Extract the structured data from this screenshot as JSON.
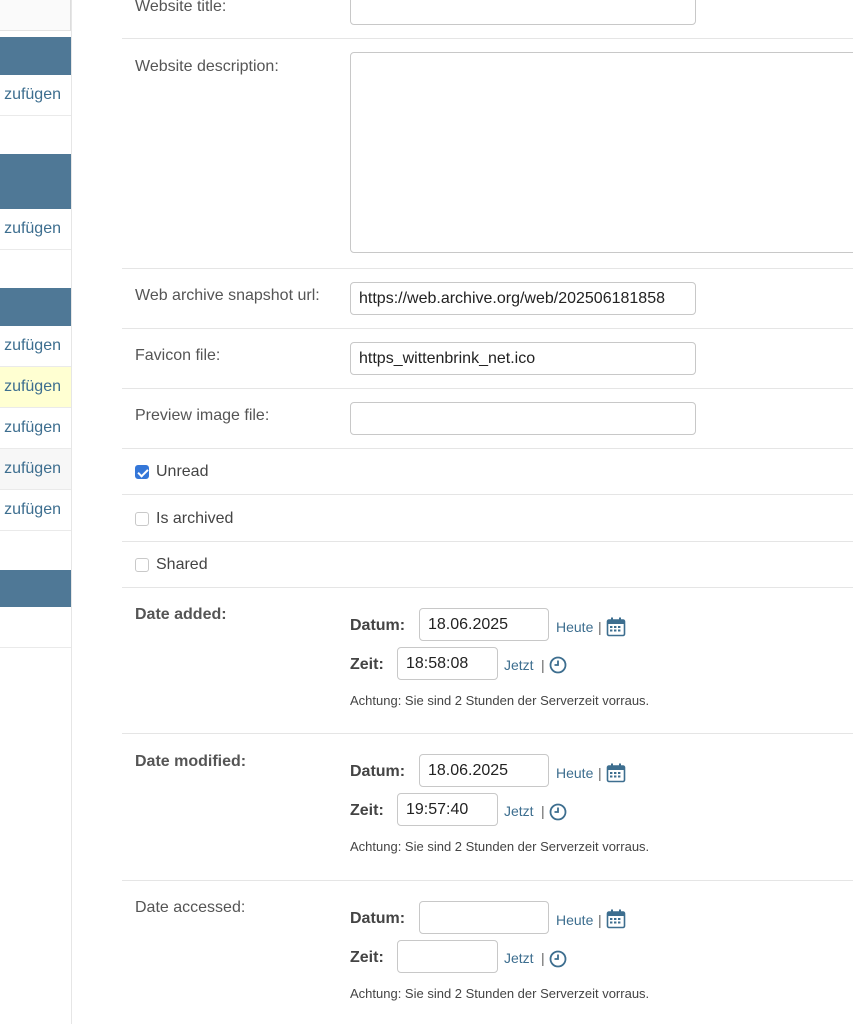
{
  "sidebar": {
    "add_links": [
      {
        "label": "zufügen"
      },
      {
        "label": "zufügen"
      },
      {
        "label": "zufügen"
      },
      {
        "label": "zufügen"
      },
      {
        "label": "zufügen"
      },
      {
        "label": "zufügen"
      },
      {
        "label": "zufügen"
      }
    ]
  },
  "form": {
    "website_title_label": "Website title:",
    "website_title_value": "",
    "website_description_label": "Website description:",
    "website_description_value": "",
    "web_archive_label": "Web archive snapshot url:",
    "web_archive_value": "https://web.archive.org/web/202506181858",
    "favicon_label": "Favicon file:",
    "favicon_value": "https_wittenbrink_net.ico",
    "preview_label": "Preview image file:",
    "preview_value": "",
    "unread_label": "Unread",
    "unread_checked": true,
    "archived_label": "Is archived",
    "archived_checked": false,
    "shared_label": "Shared",
    "shared_checked": false
  },
  "dates": [
    {
      "label": "Date added:",
      "datum_label": "Datum:",
      "datum_value": "18.06.2025",
      "today": "Heute",
      "zeit_label": "Zeit:",
      "zeit_value": "18:58:08",
      "now": "Jetzt",
      "note": "Achtung: Sie sind 2 Stunden der Serverzeit vorraus.",
      "bold": true
    },
    {
      "label": "Date modified:",
      "datum_label": "Datum:",
      "datum_value": "18.06.2025",
      "today": "Heute",
      "zeit_label": "Zeit:",
      "zeit_value": "19:57:40",
      "now": "Jetzt",
      "note": "Achtung: Sie sind 2 Stunden der Serverzeit vorraus.",
      "bold": true
    },
    {
      "label": "Date accessed:",
      "datum_label": "Datum:",
      "datum_value": "",
      "today": "Heute",
      "zeit_label": "Zeit:",
      "zeit_value": "",
      "now": "Jetzt",
      "note": "Achtung: Sie sind 2 Stunden der Serverzeit vorraus.",
      "bold": false
    }
  ],
  "separator": "|",
  "colors": {
    "accent": "#3d6e8f",
    "sidebar_header": "#4f7896",
    "checkbox": "#3577d8"
  }
}
